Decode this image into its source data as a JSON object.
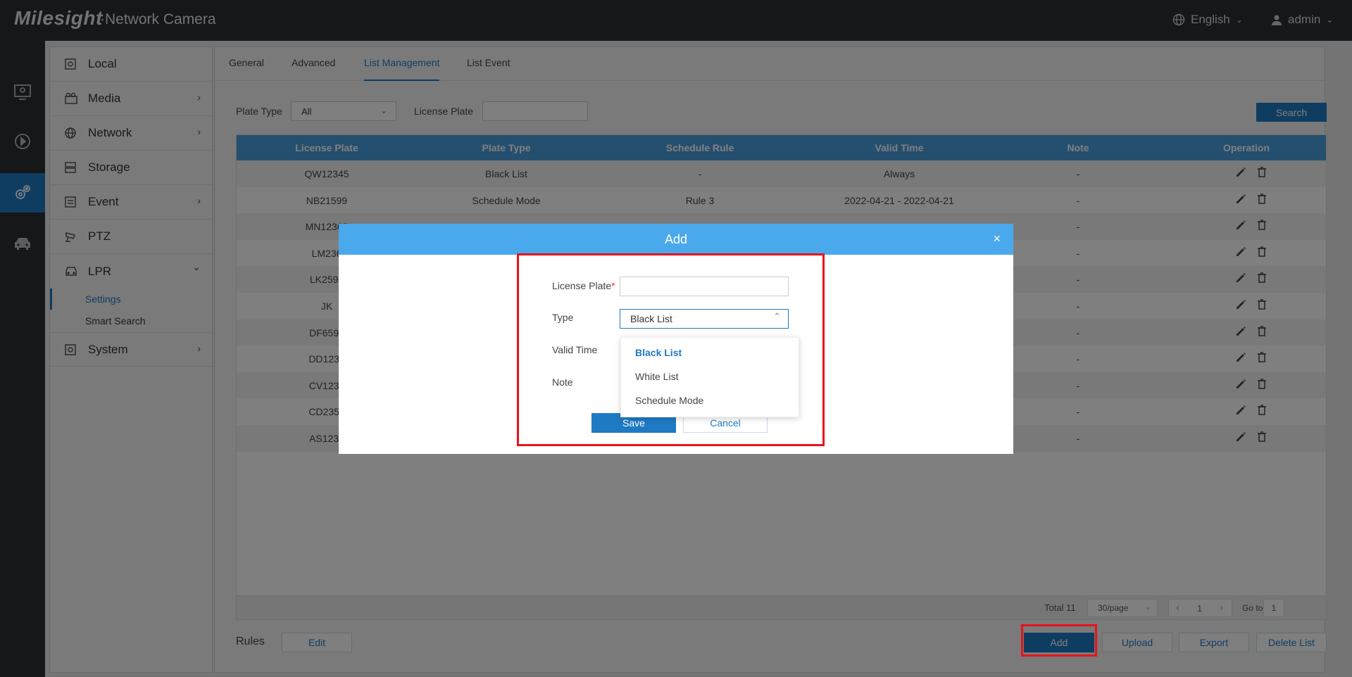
{
  "header": {
    "logo": "Milesight",
    "subtitle": "·Network Camera",
    "language": "English",
    "user": "admin"
  },
  "rail": [
    {
      "icon": "live-view-icon"
    },
    {
      "icon": "playback-icon"
    },
    {
      "icon": "settings-icon",
      "active": true
    },
    {
      "icon": "vehicle-icon"
    }
  ],
  "nav": {
    "items": [
      {
        "label": "Local",
        "icon": "local-icon",
        "arrow": ""
      },
      {
        "label": "Media",
        "icon": "media-icon",
        "arrow": "›"
      },
      {
        "label": "Network",
        "icon": "globe-icon",
        "arrow": "›"
      },
      {
        "label": "Storage",
        "icon": "storage-icon",
        "arrow": ""
      },
      {
        "label": "Event",
        "icon": "event-icon",
        "arrow": "›"
      },
      {
        "label": "PTZ",
        "icon": "ptz-icon",
        "arrow": ""
      },
      {
        "label": "LPR",
        "icon": "car-icon",
        "arrow": "⌄"
      },
      {
        "label": "System",
        "icon": "system-icon",
        "arrow": "›"
      }
    ],
    "lpr_sub": [
      "Settings",
      "Smart Search"
    ]
  },
  "tabs": [
    "General",
    "Advanced",
    "List Management",
    "List Event"
  ],
  "filters": {
    "plate_type_label": "Plate Type",
    "plate_type_value": "All",
    "license_plate_label": "License Plate",
    "search_button": "Search"
  },
  "table": {
    "headers": [
      "License Plate",
      "Plate Type",
      "Schedule Rule",
      "Valid Time",
      "Note",
      "Operation"
    ],
    "rows": [
      [
        "QW12345",
        "Black List",
        "-",
        "Always",
        "-"
      ],
      [
        "NB21599",
        "Schedule Mode",
        "Rule 3",
        "2022-04-21 - 2022-04-21",
        "-"
      ],
      [
        "MN12365",
        "",
        "",
        "",
        "-"
      ],
      [
        "LM236",
        "",
        "",
        "",
        "-"
      ],
      [
        "LK2596",
        "",
        "",
        "",
        "-"
      ],
      [
        "JK",
        "",
        "",
        "",
        "-"
      ],
      [
        "DF6598",
        "",
        "",
        "",
        "-"
      ],
      [
        "DD1231",
        "",
        "",
        "",
        "-"
      ],
      [
        "CV1236",
        "",
        "",
        "",
        "-"
      ],
      [
        "CD2356",
        "",
        "",
        "",
        "-"
      ],
      [
        "AS1235",
        "",
        "",
        "",
        "-"
      ]
    ]
  },
  "pager": {
    "total": "Total 11",
    "per_page": "30/page",
    "prev": "‹",
    "page": "1",
    "next": "›",
    "goto_label": "Go to",
    "goto_value": "1"
  },
  "bottom": {
    "rules_label": "Rules",
    "edit_button": "Edit",
    "add_button": "Add",
    "upload_button": "Upload",
    "export_button": "Export",
    "delete_button": "Delete List"
  },
  "modal": {
    "title": "Add",
    "close": "×",
    "license_plate_label": "License Plate",
    "required_mark": "*",
    "type_label": "Type",
    "type_value": "Black List",
    "valid_time_label": "Valid Time",
    "note_label": "Note",
    "options": [
      "Black List",
      "White List",
      "Schedule Mode"
    ],
    "save_button": "Save",
    "cancel_button": "Cancel"
  },
  "colors": {
    "accent": "#1f7ac4",
    "header_bg": "#2b2e33",
    "table_head": "#4a9fde",
    "modal_head": "#4aa9ec",
    "highlight": "#e8121a"
  }
}
